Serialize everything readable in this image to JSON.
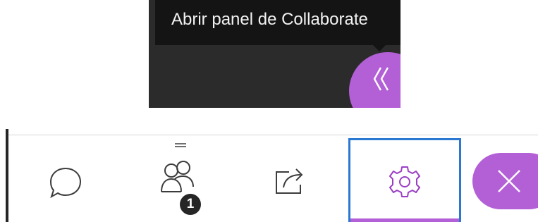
{
  "tooltip": {
    "text": "Abrir panel de Collaborate"
  },
  "toolbar": {
    "attendees_badge": "1"
  },
  "icons": {
    "open_panel": "double-chevron-left-icon",
    "chat": "chat-bubble-icon",
    "attendees": "attendees-icon",
    "share": "share-content-icon",
    "settings": "gear-icon",
    "close": "close-icon",
    "handle": "drag-handle-icon"
  },
  "colors": {
    "accent_purple": "#b35fd6",
    "focus_blue": "#2b78d3",
    "dark_background": "#2b2b2b",
    "tooltip_background": "#141414",
    "icon_gray": "#3c3c3c",
    "settings_icon": "#9b3fc4"
  }
}
